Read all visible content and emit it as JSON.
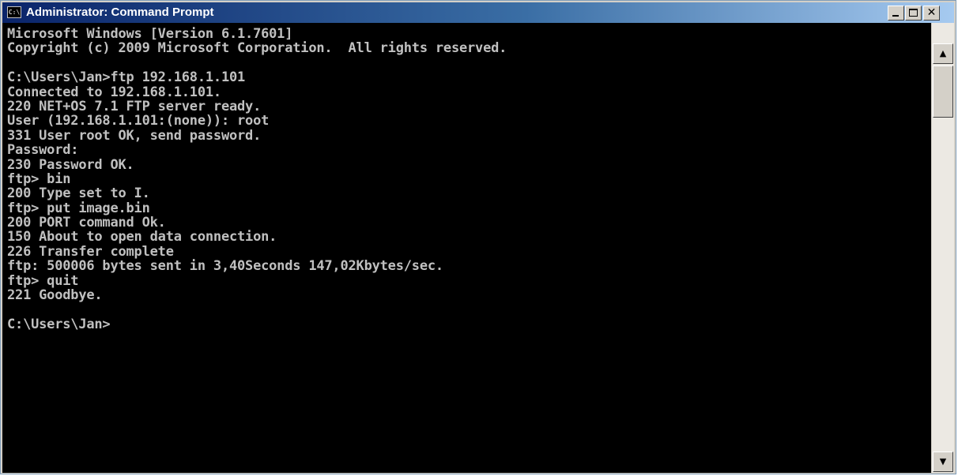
{
  "window": {
    "title": "Administrator: Command Prompt",
    "icon": "cmd-icon",
    "icon_text": "C:\\",
    "caption_buttons": [
      "minimize-icon",
      "maximize-icon",
      "close-icon"
    ],
    "close_glyph": "✕"
  },
  "scrollbar": {
    "up_glyph": "▲",
    "down_glyph": "▼"
  },
  "colors": {
    "console_background": "#000000",
    "console_text": "#c0c0c0",
    "title_gradient_start": "#0a246a",
    "title_gradient_end": "#a6caf0"
  },
  "console": {
    "lines": [
      "Microsoft Windows [Version 6.1.7601]",
      "Copyright (c) 2009 Microsoft Corporation.  All rights reserved.",
      "",
      "C:\\Users\\Jan>ftp 192.168.1.101",
      "Connected to 192.168.1.101.",
      "220 NET+OS 7.1 FTP server ready.",
      "User (192.168.1.101:(none)): root",
      "331 User root OK, send password.",
      "Password:",
      "230 Password OK.",
      "ftp> bin",
      "200 Type set to I.",
      "ftp> put image.bin",
      "200 PORT command Ok.",
      "150 About to open data connection.",
      "226 Transfer complete",
      "ftp: 500006 bytes sent in 3,40Seconds 147,02Kbytes/sec.",
      "ftp> quit",
      "221 Goodbye.",
      "",
      "C:\\Users\\Jan>"
    ]
  }
}
